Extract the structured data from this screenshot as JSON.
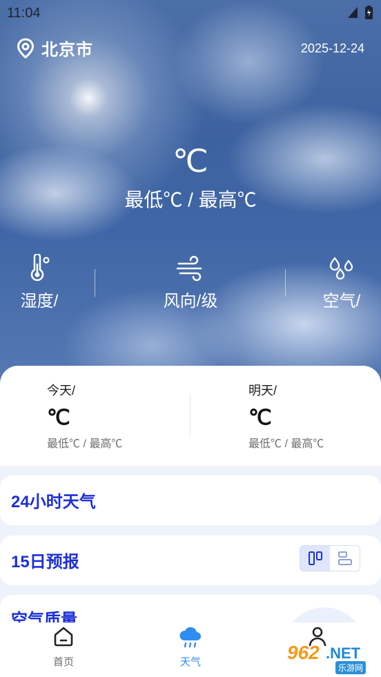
{
  "status_bar": {
    "time": "11:04"
  },
  "header": {
    "city": "北京市",
    "date": "2025-12-24"
  },
  "current": {
    "temp": "℃",
    "range": "最低℃  /  最高℃"
  },
  "metrics": [
    {
      "label": "湿度/",
      "icon": "thermometer-icon"
    },
    {
      "label": "风向/级",
      "icon": "wind-icon"
    },
    {
      "label": "空气/",
      "icon": "droplets-icon"
    }
  ],
  "forecast": {
    "today": {
      "title": "今天/",
      "temp": "℃",
      "range": "最低℃ / 最高℃"
    },
    "tomorrow": {
      "title": "明天/",
      "temp": "℃",
      "range": "最低℃ / 最高℃"
    }
  },
  "sections": {
    "hourly_title": "24小时天气",
    "fifteen_title": "15日预报",
    "air_title": "空气质量"
  },
  "nav": [
    {
      "label": "首页",
      "icon": "home-icon"
    },
    {
      "label": "天气",
      "icon": "weather-cloud-icon",
      "active": true
    },
    {
      "label": "",
      "icon": "profile-icon"
    }
  ],
  "watermark": {
    "brand": "962",
    "suffix": ".NET",
    "sub": "乐游网"
  },
  "colors": {
    "accent": "#1c2fd6",
    "nav_active": "#2f8df2",
    "nav_inactive": "#6b6b6b"
  }
}
